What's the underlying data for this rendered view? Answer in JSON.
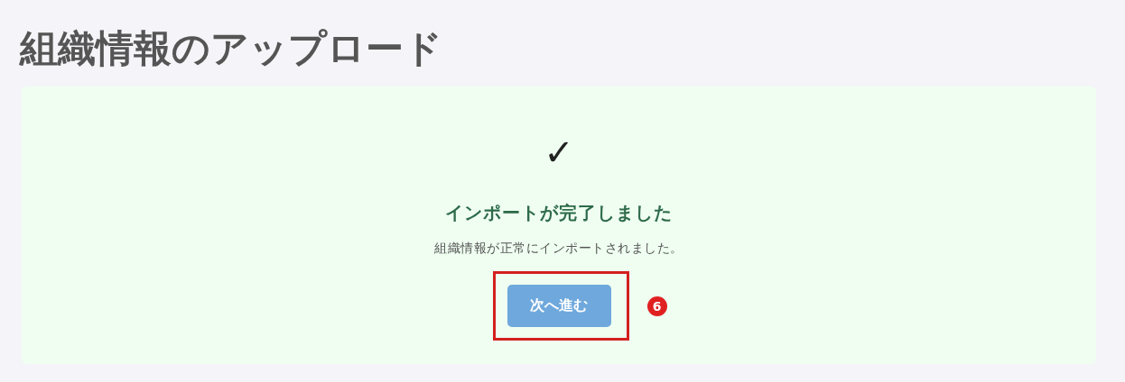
{
  "title": "組織情報のアップロード",
  "result": {
    "icon": "✓",
    "heading": "インポートが完了しました",
    "message": "組織情報が正常にインポートされました。",
    "button": "次へ進む"
  },
  "annotation": {
    "label": "6"
  }
}
